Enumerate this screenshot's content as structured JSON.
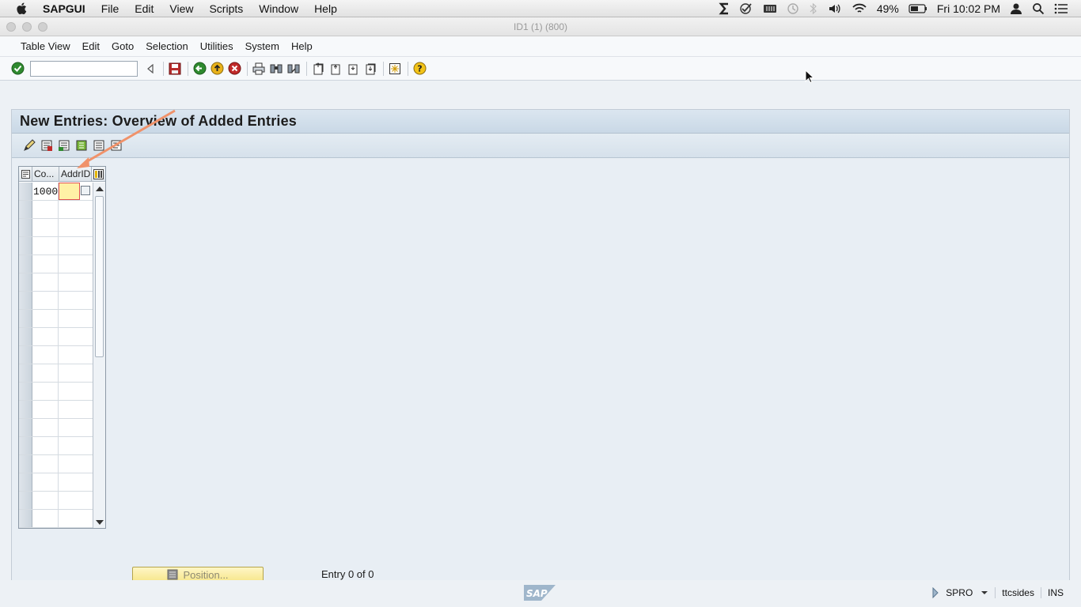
{
  "mac_menubar": {
    "app_name": "SAPGUI",
    "menus": [
      "File",
      "Edit",
      "View",
      "Scripts",
      "Window",
      "Help"
    ],
    "battery": "49%",
    "clock": "Fri 10:02 PM"
  },
  "window": {
    "title": "ID1 (1) (800)"
  },
  "sap_menu": [
    "Table View",
    "Edit",
    "Goto",
    "Selection",
    "Utilities",
    "System",
    "Help"
  ],
  "toolbar": {
    "command_field_value": ""
  },
  "screen": {
    "title": "New Entries: Overview of Added Entries"
  },
  "table": {
    "columns": [
      "Co...",
      "AddrID"
    ],
    "rows": [
      [
        "1000",
        ""
      ],
      [
        "",
        ""
      ],
      [
        "",
        ""
      ],
      [
        "",
        ""
      ],
      [
        "",
        ""
      ],
      [
        "",
        ""
      ],
      [
        "",
        ""
      ],
      [
        "",
        ""
      ],
      [
        "",
        ""
      ],
      [
        "",
        ""
      ],
      [
        "",
        ""
      ],
      [
        "",
        ""
      ],
      [
        "",
        ""
      ],
      [
        "",
        ""
      ],
      [
        "",
        ""
      ],
      [
        "",
        ""
      ],
      [
        "",
        ""
      ],
      [
        "",
        ""
      ],
      [
        "",
        ""
      ]
    ]
  },
  "footer": {
    "position_button": "Position...",
    "entry_text": "Entry 0 of 0"
  },
  "status": {
    "transaction": "SPRO",
    "server": "ttcsides",
    "mode": "INS"
  },
  "colors": {
    "accent_arrow": "#f0926a",
    "input_highlight": "#fff1a6",
    "title_bar": "#c9d8e6"
  }
}
